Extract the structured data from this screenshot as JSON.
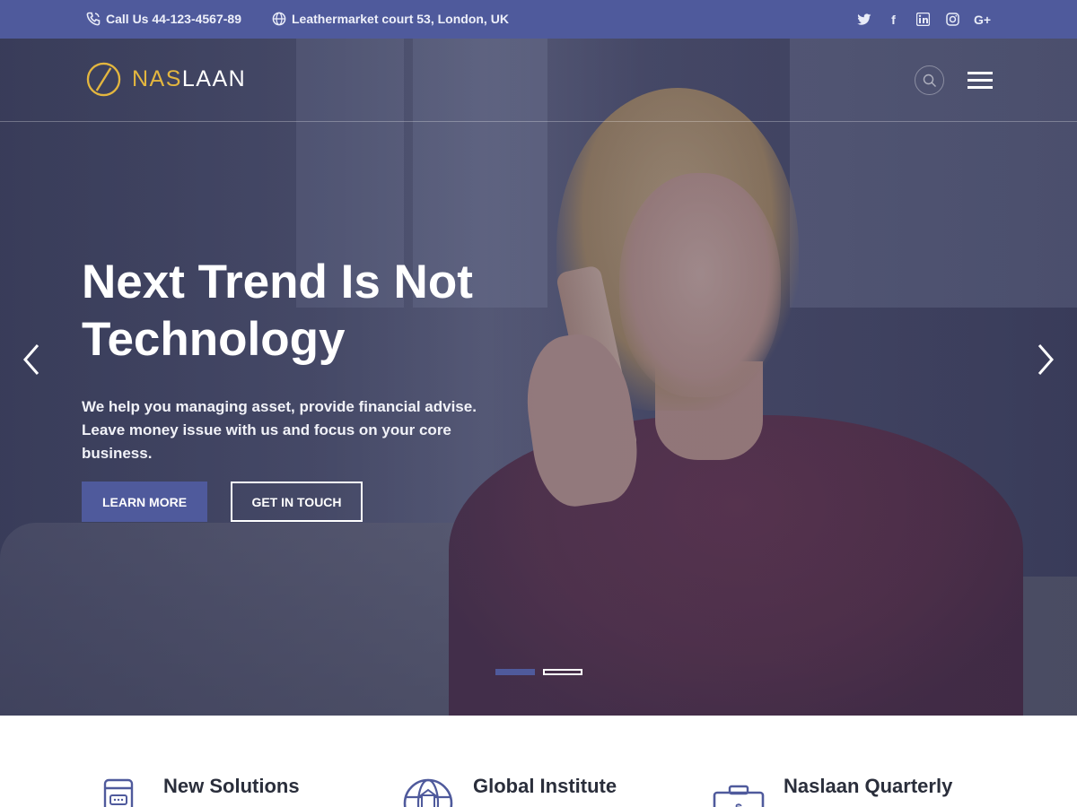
{
  "colors": {
    "accent": "#4f5a9c",
    "logo_gold": "#e3b63f",
    "text_dark": "#2a2e3b"
  },
  "topbar": {
    "phone_icon": "phone-icon",
    "phone": "Call Us 44-123-4567-89",
    "address_icon": "globe-icon",
    "address": "Leathermarket court 53, London, UK",
    "social": [
      {
        "name": "twitter-icon",
        "glyph": ""
      },
      {
        "name": "facebook-icon",
        "glyph": "f"
      },
      {
        "name": "linkedin-icon",
        "glyph": ""
      },
      {
        "name": "instagram-icon",
        "glyph": ""
      },
      {
        "name": "google-plus-icon",
        "glyph": "G+"
      }
    ]
  },
  "header": {
    "logo_part1": "NAS",
    "logo_part2": "LAAN",
    "search_icon": "search-icon",
    "menu_icon": "hamburger-menu-icon"
  },
  "hero": {
    "headline_line1": "Next Trend Is Not",
    "headline_line2": "Technology",
    "subtitle": "We help you managing asset, provide financial advise. Leave money issue with us and focus on your core business.",
    "primary_button": "LEARN MORE",
    "secondary_button": "GET IN TOUCH",
    "prev_icon": "chevron-left-icon",
    "next_icon": "chevron-right-icon",
    "slides": 2,
    "active_slide": 1
  },
  "features": [
    {
      "title": "New Solutions",
      "icon": "device-icon"
    },
    {
      "title": "Global Institute",
      "icon": "globe-building-icon"
    },
    {
      "title": "Naslaan Quarterly",
      "icon": "briefcase-dollar-icon"
    }
  ]
}
